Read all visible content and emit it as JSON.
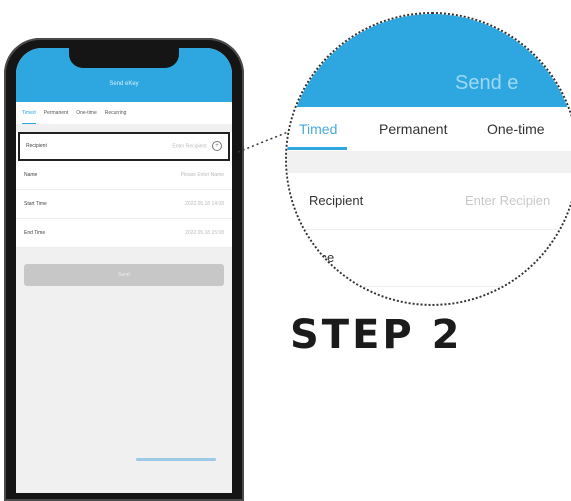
{
  "phone": {
    "header_title": "Send eKey",
    "tabs": [
      "Timed",
      "Permanent",
      "One-time",
      "Recurring"
    ],
    "rows": [
      {
        "label": "Recipient",
        "value": "Enter Recipient"
      },
      {
        "label": "Name",
        "value": "Please Enter Name"
      },
      {
        "label": "Start Time",
        "value": "2022.05.18 14:08"
      },
      {
        "label": "End Time",
        "value": "2022.05.18 15:08"
      }
    ],
    "send_button": "Send"
  },
  "magnifier": {
    "title": "Send e",
    "tabs": [
      "Timed",
      "Permanent",
      "One-time"
    ],
    "recipient_label": "Recipient",
    "recipient_placeholder": "Enter Recipien",
    "name_label": "ame"
  },
  "step_label": "STEP 2",
  "colors": {
    "accent": "#2ea7e0",
    "accent_text": "#4aa9d9",
    "button_disabled": "#c7c7c7"
  },
  "icons": {
    "add_contact": "plus-circle-icon"
  }
}
